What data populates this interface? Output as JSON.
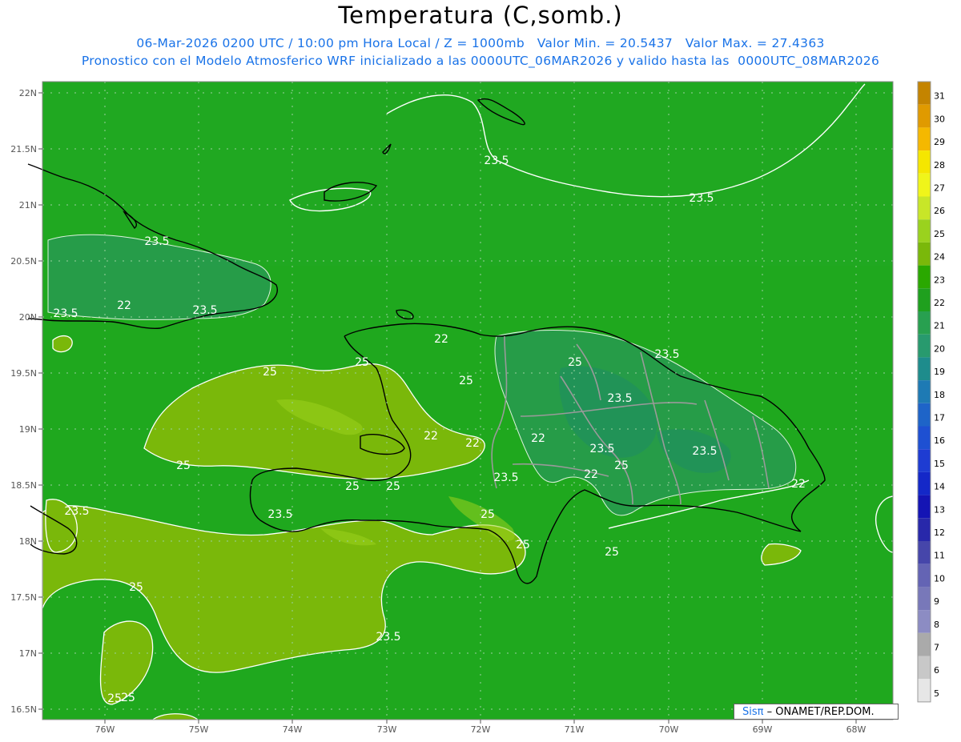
{
  "title": "Temperatura (C,somb.)",
  "subtitle_line1": "06-Mar-2026 0200 UTC / 10:00 pm Hora Local / Z = 1000mb   Valor Min. = 20.5437   Valor Max. = 27.4363",
  "subtitle_line2": "Pronostico con el Modelo Atmosferico WRF inicializado a las 0000UTC_06MAR2026 y valido hasta las  0000UTC_08MAR2026",
  "axes": {
    "lat_labels": [
      "22N",
      "21.5N",
      "21N",
      "20.5N",
      "20N",
      "19.5N",
      "19N",
      "18.5N",
      "18N",
      "17.5N",
      "17N",
      "16.5N"
    ],
    "lon_labels": [
      "76W",
      "75W",
      "74W",
      "73W",
      "72W",
      "71W",
      "70W",
      "69W",
      "68W"
    ]
  },
  "colorbar": {
    "labels": [
      "31",
      "30",
      "29",
      "28",
      "27",
      "26",
      "25",
      "24",
      "23",
      "22",
      "21",
      "20",
      "19",
      "18",
      "17",
      "16",
      "15",
      "14",
      "13",
      "12",
      "11",
      "10",
      "9",
      "8",
      "7",
      "6",
      "5"
    ],
    "colors": [
      "#c48400",
      "#e09a00",
      "#f5b800",
      "#f5e600",
      "#f0f51a",
      "#c8e628",
      "#9ad21e",
      "#7ab80a",
      "#2aa800",
      "#1fa01e",
      "#28a050",
      "#289a6e",
      "#1e8c8c",
      "#1e7ab4",
      "#1e64c8",
      "#1e50d2",
      "#1e3cd2",
      "#1428c8",
      "#1414b4",
      "#2828aa",
      "#4646aa",
      "#6464b4",
      "#7878b9",
      "#8c8cc3",
      "#aaaaaa",
      "#c8c8c8",
      "#e6e6e6"
    ]
  },
  "contour_labels": [
    "23.5",
    "23.5",
    "23.5",
    "22",
    "23.5",
    "23.5",
    "22",
    "23.5",
    "25",
    "25",
    "25",
    "25",
    "23.5",
    "22",
    "22",
    "22",
    "23.5",
    "25",
    "23.5",
    "25",
    "25",
    "25",
    "23.5",
    "22",
    "22",
    "23.5",
    "23.5",
    "25",
    "25",
    "25",
    "25",
    "23.5",
    "25",
    "25"
  ],
  "credit": {
    "brand": "Sis",
    "pi": "π",
    "org": "ONAMET/REP.DOM."
  }
}
